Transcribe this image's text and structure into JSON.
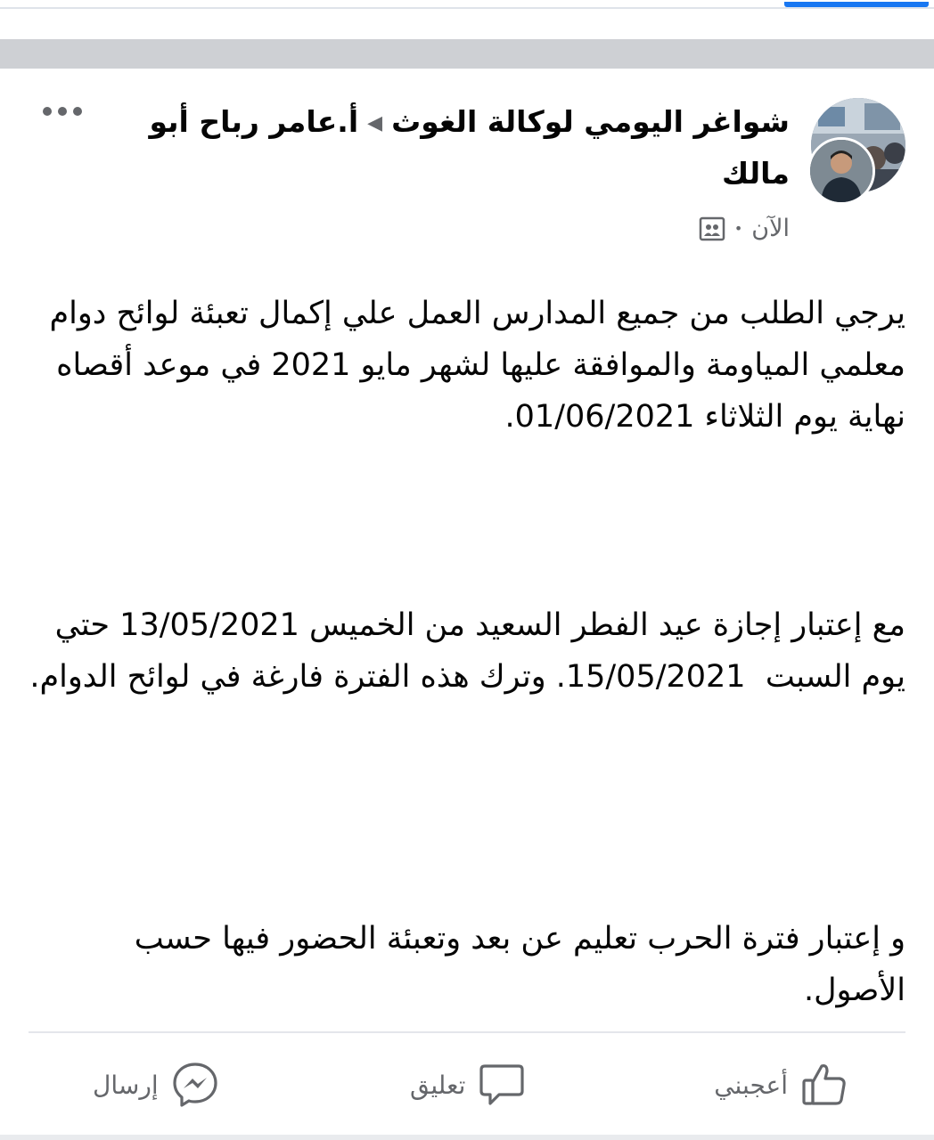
{
  "post": {
    "group_name": "شواغر اليومي لوكالة الغوث",
    "author_name": "أ.عامر رباح أبو مالك",
    "timestamp": "الآن",
    "audience_icon": "group-audience-icon",
    "paragraphs": [
      "يرجي الطلب من جميع المدارس العمل علي إكمال تعبئة لوائح دوام معلمي المياومة والموافقة عليها لشهر مايو 2021 في موعد أقصاه نهاية يوم الثلاثاء 01/06/2021.",
      "مع إعتبار إجازة عيد الفطر السعيد من الخميس 13/05/2021 حتي يوم السبت  15/05/2021. وترك هذه الفترة فارغة في لوائح الدوام.",
      "و إعتبار فترة الحرب تعليم عن بعد وتعبئة الحضور فيها حسب الأصول."
    ]
  },
  "actions": {
    "like_label": "أعجبني",
    "comment_label": "تعليق",
    "send_label": "إرسال"
  },
  "colors": {
    "accent": "#1877f2",
    "secondary_text": "#65676b",
    "separator": "#ced0d4"
  }
}
